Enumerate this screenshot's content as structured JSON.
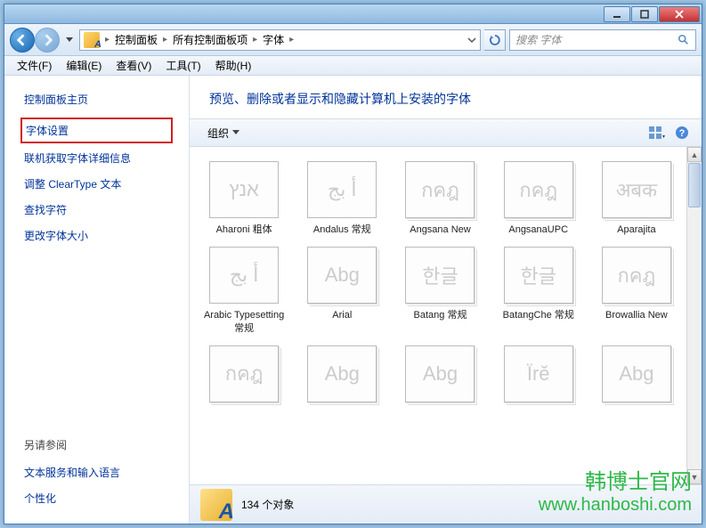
{
  "titlebar": {
    "min": "—",
    "max": "☐",
    "close": "✕"
  },
  "breadcrumbs": [
    "控制面板",
    "所有控制面板项",
    "字体"
  ],
  "search": {
    "placeholder": "搜索 字体"
  },
  "menu": [
    "文件(F)",
    "编辑(E)",
    "查看(V)",
    "工具(T)",
    "帮助(H)"
  ],
  "sidebar": {
    "home": "控制面板主页",
    "links": [
      "字体设置",
      "联机获取字体详细信息",
      "调整 ClearType 文本",
      "查找字符",
      "更改字体大小"
    ],
    "footer_title": "另请参阅",
    "footer_links": [
      "文本服务和输入语言",
      "个性化"
    ]
  },
  "main": {
    "header": "预览、删除或者显示和隐藏计算机上安装的字体",
    "organize": "组织"
  },
  "fonts": [
    {
      "label": "Aharoni 粗体",
      "sample": "אנץ",
      "single": true
    },
    {
      "label": "Andalus 常规",
      "sample": "أ بج",
      "single": true
    },
    {
      "label": "Angsana New",
      "sample": "กคฎ"
    },
    {
      "label": "AngsanaUPC",
      "sample": "กคฎ"
    },
    {
      "label": "Aparajita",
      "sample": "अबक"
    },
    {
      "label": "Arabic Typesetting 常规",
      "sample": "أ بج",
      "single": true
    },
    {
      "label": "Arial",
      "sample": "Abg"
    },
    {
      "label": "Batang 常规",
      "sample": "한글"
    },
    {
      "label": "BatangChe 常规",
      "sample": "한글"
    },
    {
      "label": "Browallia New",
      "sample": "กคฎ"
    },
    {
      "label": "",
      "sample": "กคฎ"
    },
    {
      "label": "",
      "sample": "Abg"
    },
    {
      "label": "",
      "sample": "Abg"
    },
    {
      "label": "",
      "sample": "Ïrĕ"
    },
    {
      "label": "",
      "sample": "Abg"
    }
  ],
  "status": {
    "count": "134 个对象"
  },
  "watermark": {
    "line1": "韩博士官网",
    "line2": "www.hanboshi.com"
  }
}
